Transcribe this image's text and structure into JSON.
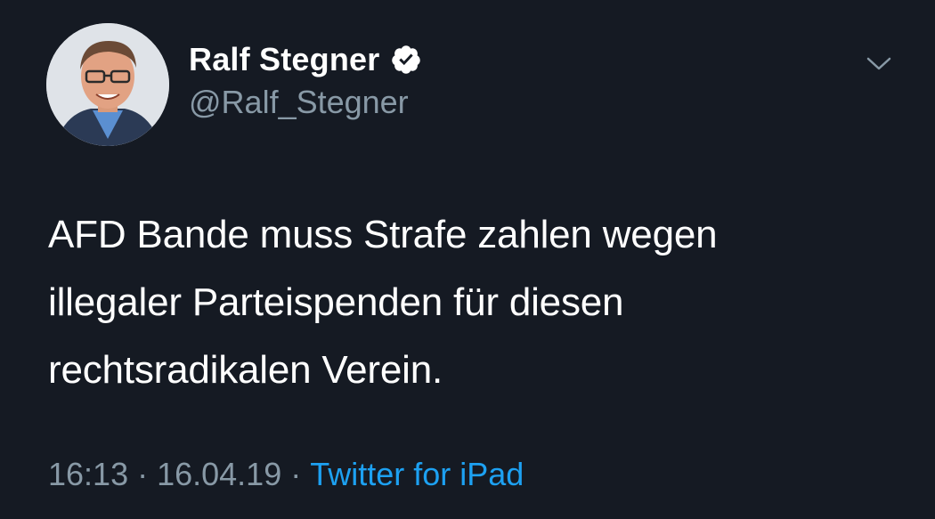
{
  "author": {
    "display_name": "Ralf Stegner",
    "handle": "@Ralf_Stegner",
    "verified_icon": "verified-badge-icon",
    "avatar_icon": "profile-photo"
  },
  "tweet": {
    "lines": [
      "AFD Bande muss Strafe zahlen wegen",
      "illegaler Parteispenden für diesen",
      "rechtsradikalen Verein."
    ]
  },
  "meta": {
    "time": "16:13",
    "separator": "·",
    "date": "16.04.19",
    "source": "Twitter for iPad"
  },
  "menu": {
    "icon": "chevron-down-icon"
  },
  "colors": {
    "background": "#151a23",
    "text": "#ffffff",
    "secondary": "#8899a6",
    "link": "#1da1f2",
    "verified": "#ffffff"
  }
}
